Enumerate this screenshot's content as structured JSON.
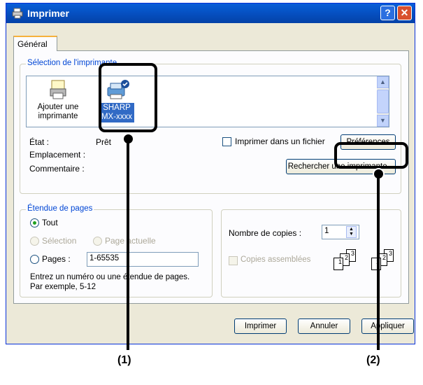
{
  "window": {
    "title": "Imprimer",
    "help_label": "?",
    "close_label": "✕",
    "icon": "printer-icon"
  },
  "tabs": [
    {
      "label": "Général"
    }
  ],
  "printer_selection": {
    "legend": "Sélection de l'imprimante",
    "items": [
      {
        "label_line1": "Ajouter une",
        "label_line2": "imprimante",
        "icon": "add-printer-icon"
      },
      {
        "label_line1": "SHARP",
        "label_line2": "MX-xxxx",
        "icon": "printer-default-icon",
        "selected": true
      }
    ]
  },
  "status": {
    "state_label": "État :",
    "state_value": "Prêt",
    "location_label": "Emplacement :",
    "comment_label": "Commentaire :",
    "print_to_file_label": "Imprimer dans un fichier",
    "preferences_button": "Préférences",
    "find_printer_button": "Rechercher une imprimante..."
  },
  "page_range": {
    "legend": "Étendue de pages",
    "all_label": "Tout",
    "selection_label": "Sélection",
    "current_page_label": "Page actuelle",
    "pages_label": "Pages :",
    "pages_value": "1-65535",
    "help_line1": "Entrez un numéro ou une étendue de pages.",
    "help_line2": "Par exemple, 5-12"
  },
  "copies": {
    "count_label": "Nombre de copies :",
    "count_value": "1",
    "collate_label": "Copies assemblées"
  },
  "buttons": {
    "print": "Imprimer",
    "cancel": "Annuler",
    "apply": "Appliquer"
  },
  "callouts": [
    {
      "label": "(1)"
    },
    {
      "label": "(2)"
    }
  ],
  "colors": {
    "titlebar": "#0653c6",
    "legend_text": "#0046d5",
    "selection_bg": "#316ac5"
  }
}
